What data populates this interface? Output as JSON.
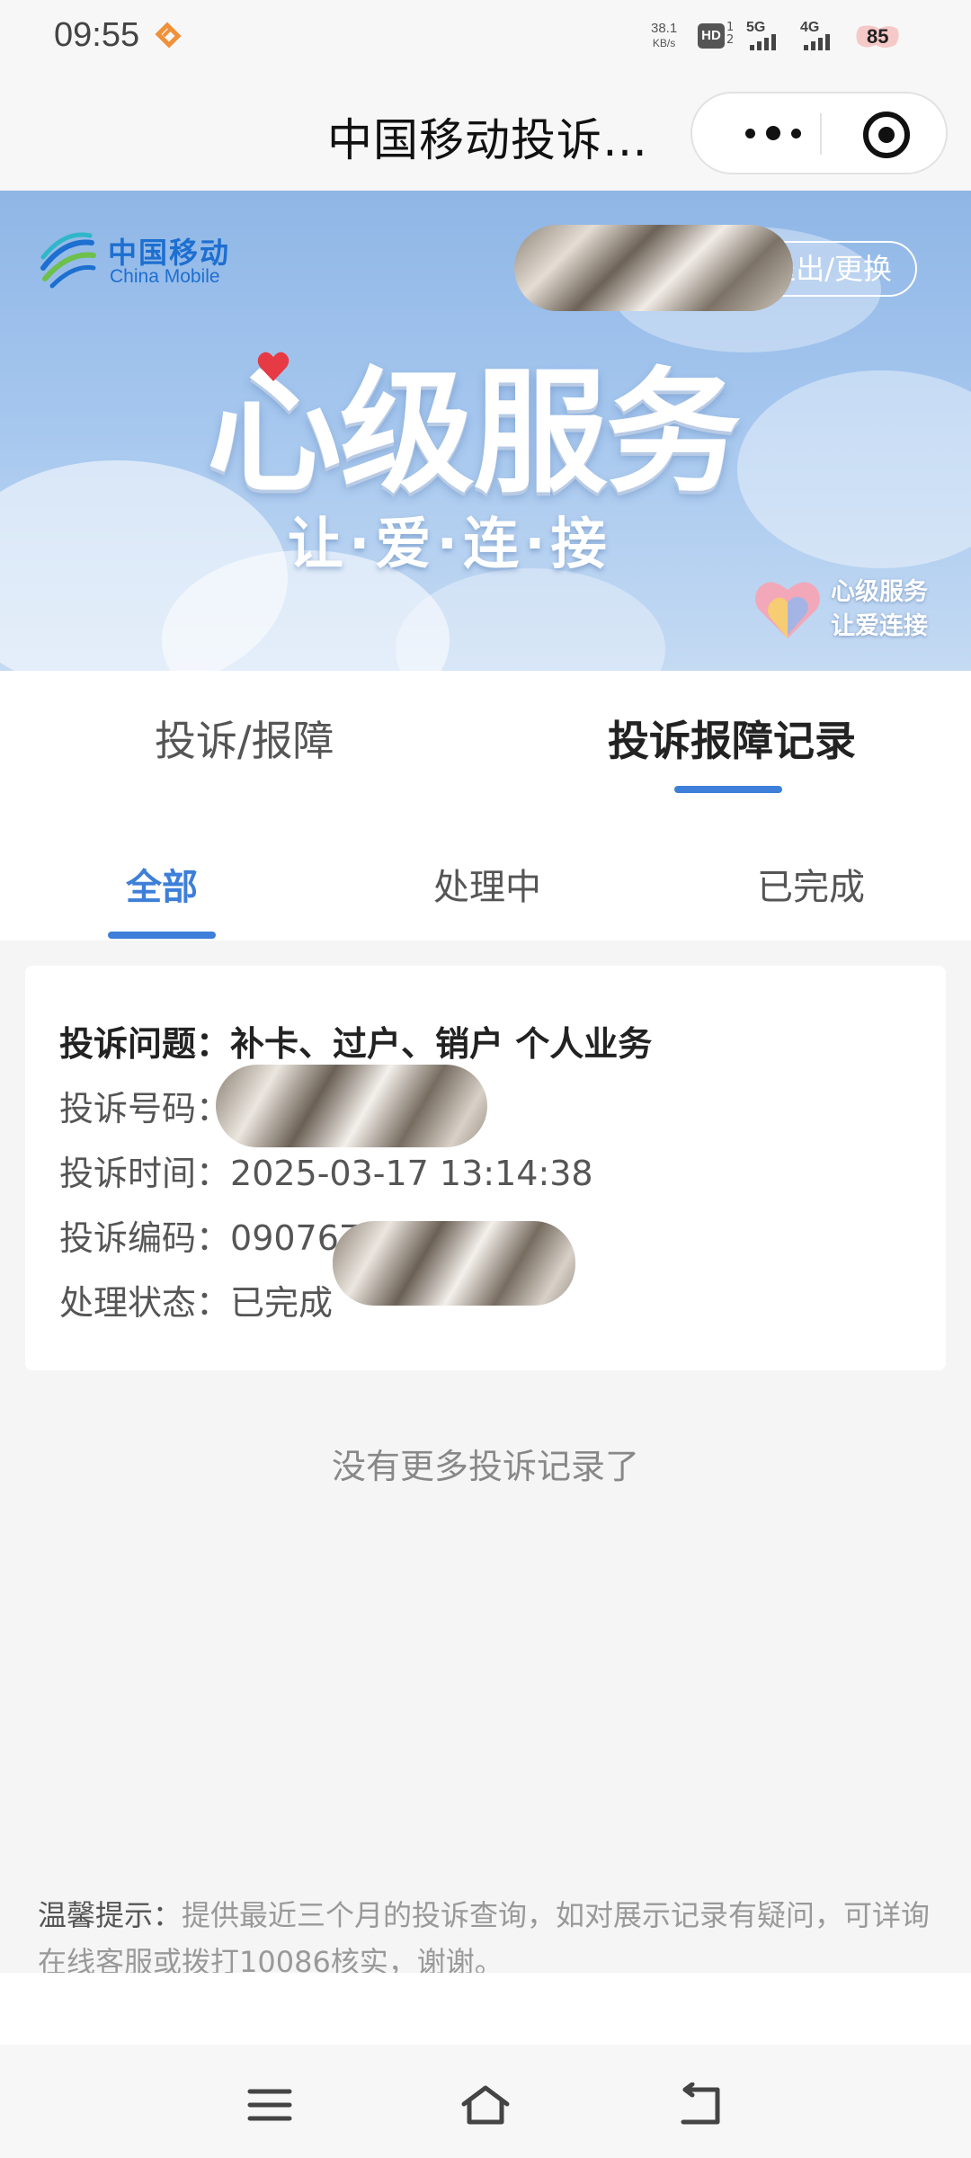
{
  "status_bar": {
    "time": "09:55",
    "net_speed_value": "38.1",
    "net_speed_unit": "KB/s",
    "hd_label": "HD",
    "hd_sub_top": "1",
    "hd_sub_bottom": "2",
    "signal_1": "5G",
    "signal_2": "4G",
    "battery": "85"
  },
  "nav_bar": {
    "title": "中国移动投诉…"
  },
  "banner": {
    "brand_cn": "中国移动",
    "brand_en": "China Mobile",
    "logout_label": "退出/更换",
    "headline": "心级服务",
    "slogan": "让·爱·连·接",
    "mini_logo_line1": "心级服务",
    "mini_logo_line2": "让爱连接"
  },
  "main_tabs": [
    {
      "label": "投诉/报障",
      "active": false
    },
    {
      "label": "投诉报障记录",
      "active": true
    }
  ],
  "sub_tabs": [
    {
      "label": "全部",
      "active": true
    },
    {
      "label": "处理中",
      "active": false
    },
    {
      "label": "已完成",
      "active": false
    }
  ],
  "record": {
    "issue_label": "投诉问题：",
    "issue_value": "补卡、过户、销户 个人业务",
    "number_label": "投诉号码：",
    "time_label": "投诉时间：",
    "time_value": "2025-03-17 13:14:38",
    "code_label": "投诉编码：",
    "code_value": "090767",
    "status_label": "处理状态：",
    "status_value": "已完成"
  },
  "no_more_text": "没有更多投诉记录了",
  "tip": {
    "label": "温馨提示：",
    "text": "提供最近三个月的投诉查询，如对展示记录有疑问，可详询在线客服或拨打10086核实，谢谢。"
  },
  "colors": {
    "accent": "#3d7fd9",
    "brand": "#1d6fd0"
  }
}
